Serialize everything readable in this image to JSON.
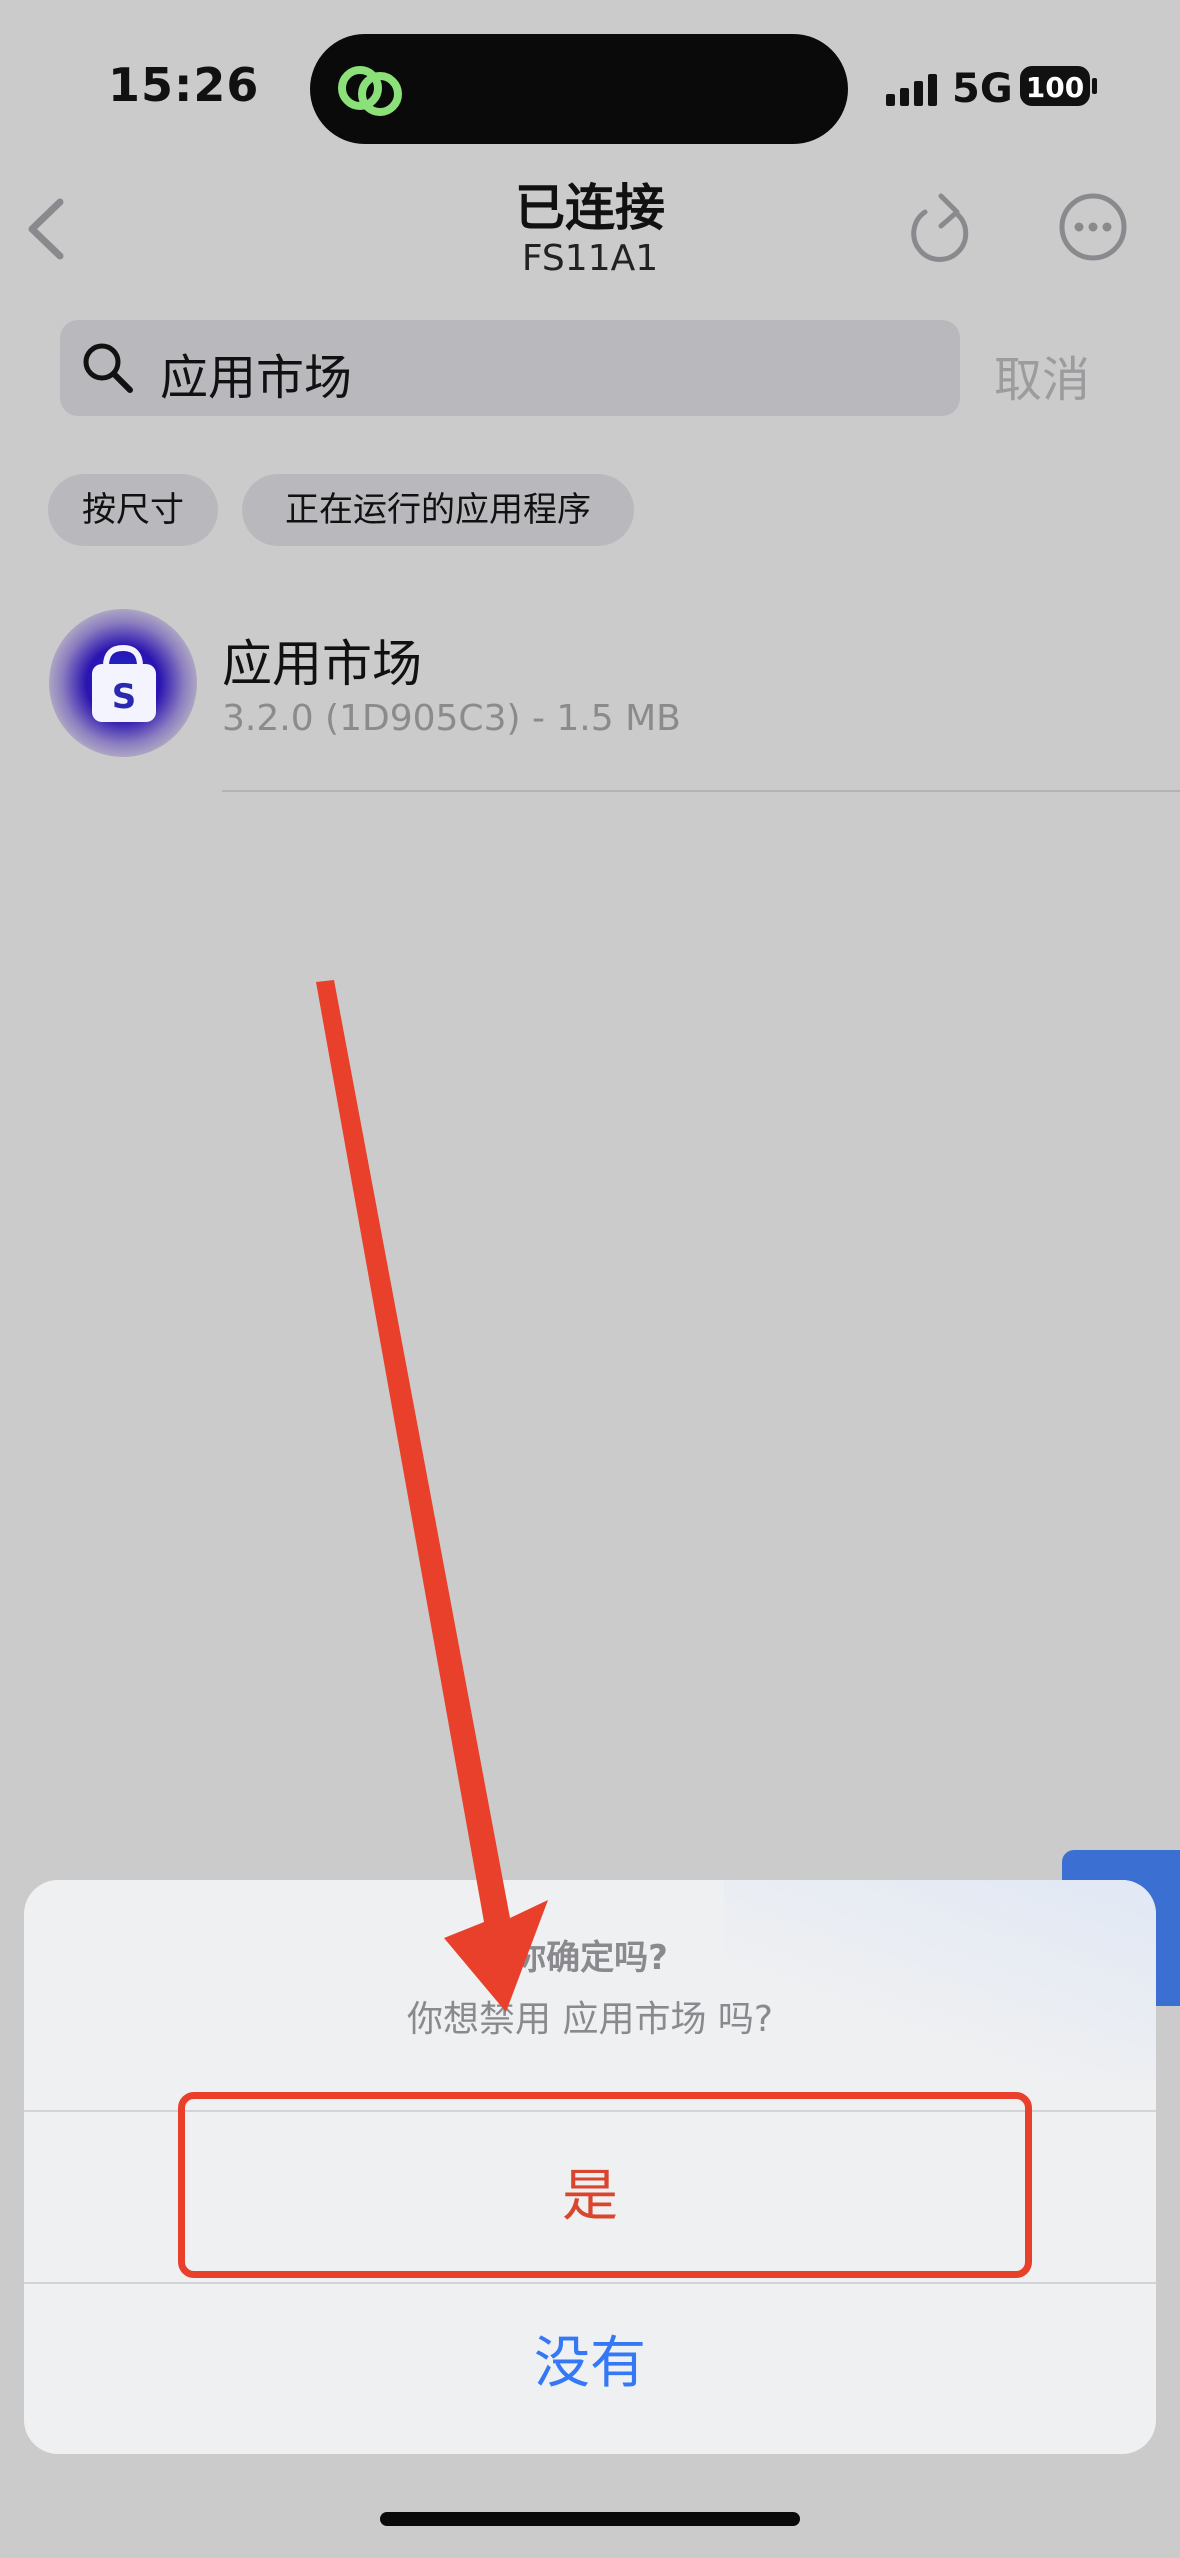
{
  "status_bar": {
    "time": "15:26",
    "network": "5G",
    "battery": "100"
  },
  "nav": {
    "title": "已连接",
    "subtitle": "FS11A1"
  },
  "search": {
    "query": "应用市场",
    "cancel_label": "取消"
  },
  "filters": [
    {
      "label": "按尺寸"
    },
    {
      "label": "正在运行的应用程序"
    }
  ],
  "app": {
    "name": "应用市场",
    "meta": "3.2.0 (1D905C3) - 1.5 MB",
    "icon_letter": "S"
  },
  "sheet": {
    "title": "你确定吗?",
    "message": "你想禁用 应用市场 吗?",
    "yes_label": "是",
    "no_label": "没有"
  },
  "colors": {
    "destructive": "#d9462d",
    "action": "#3478f6",
    "annotation": "#e8402a",
    "island_icon": "#8be07a"
  }
}
